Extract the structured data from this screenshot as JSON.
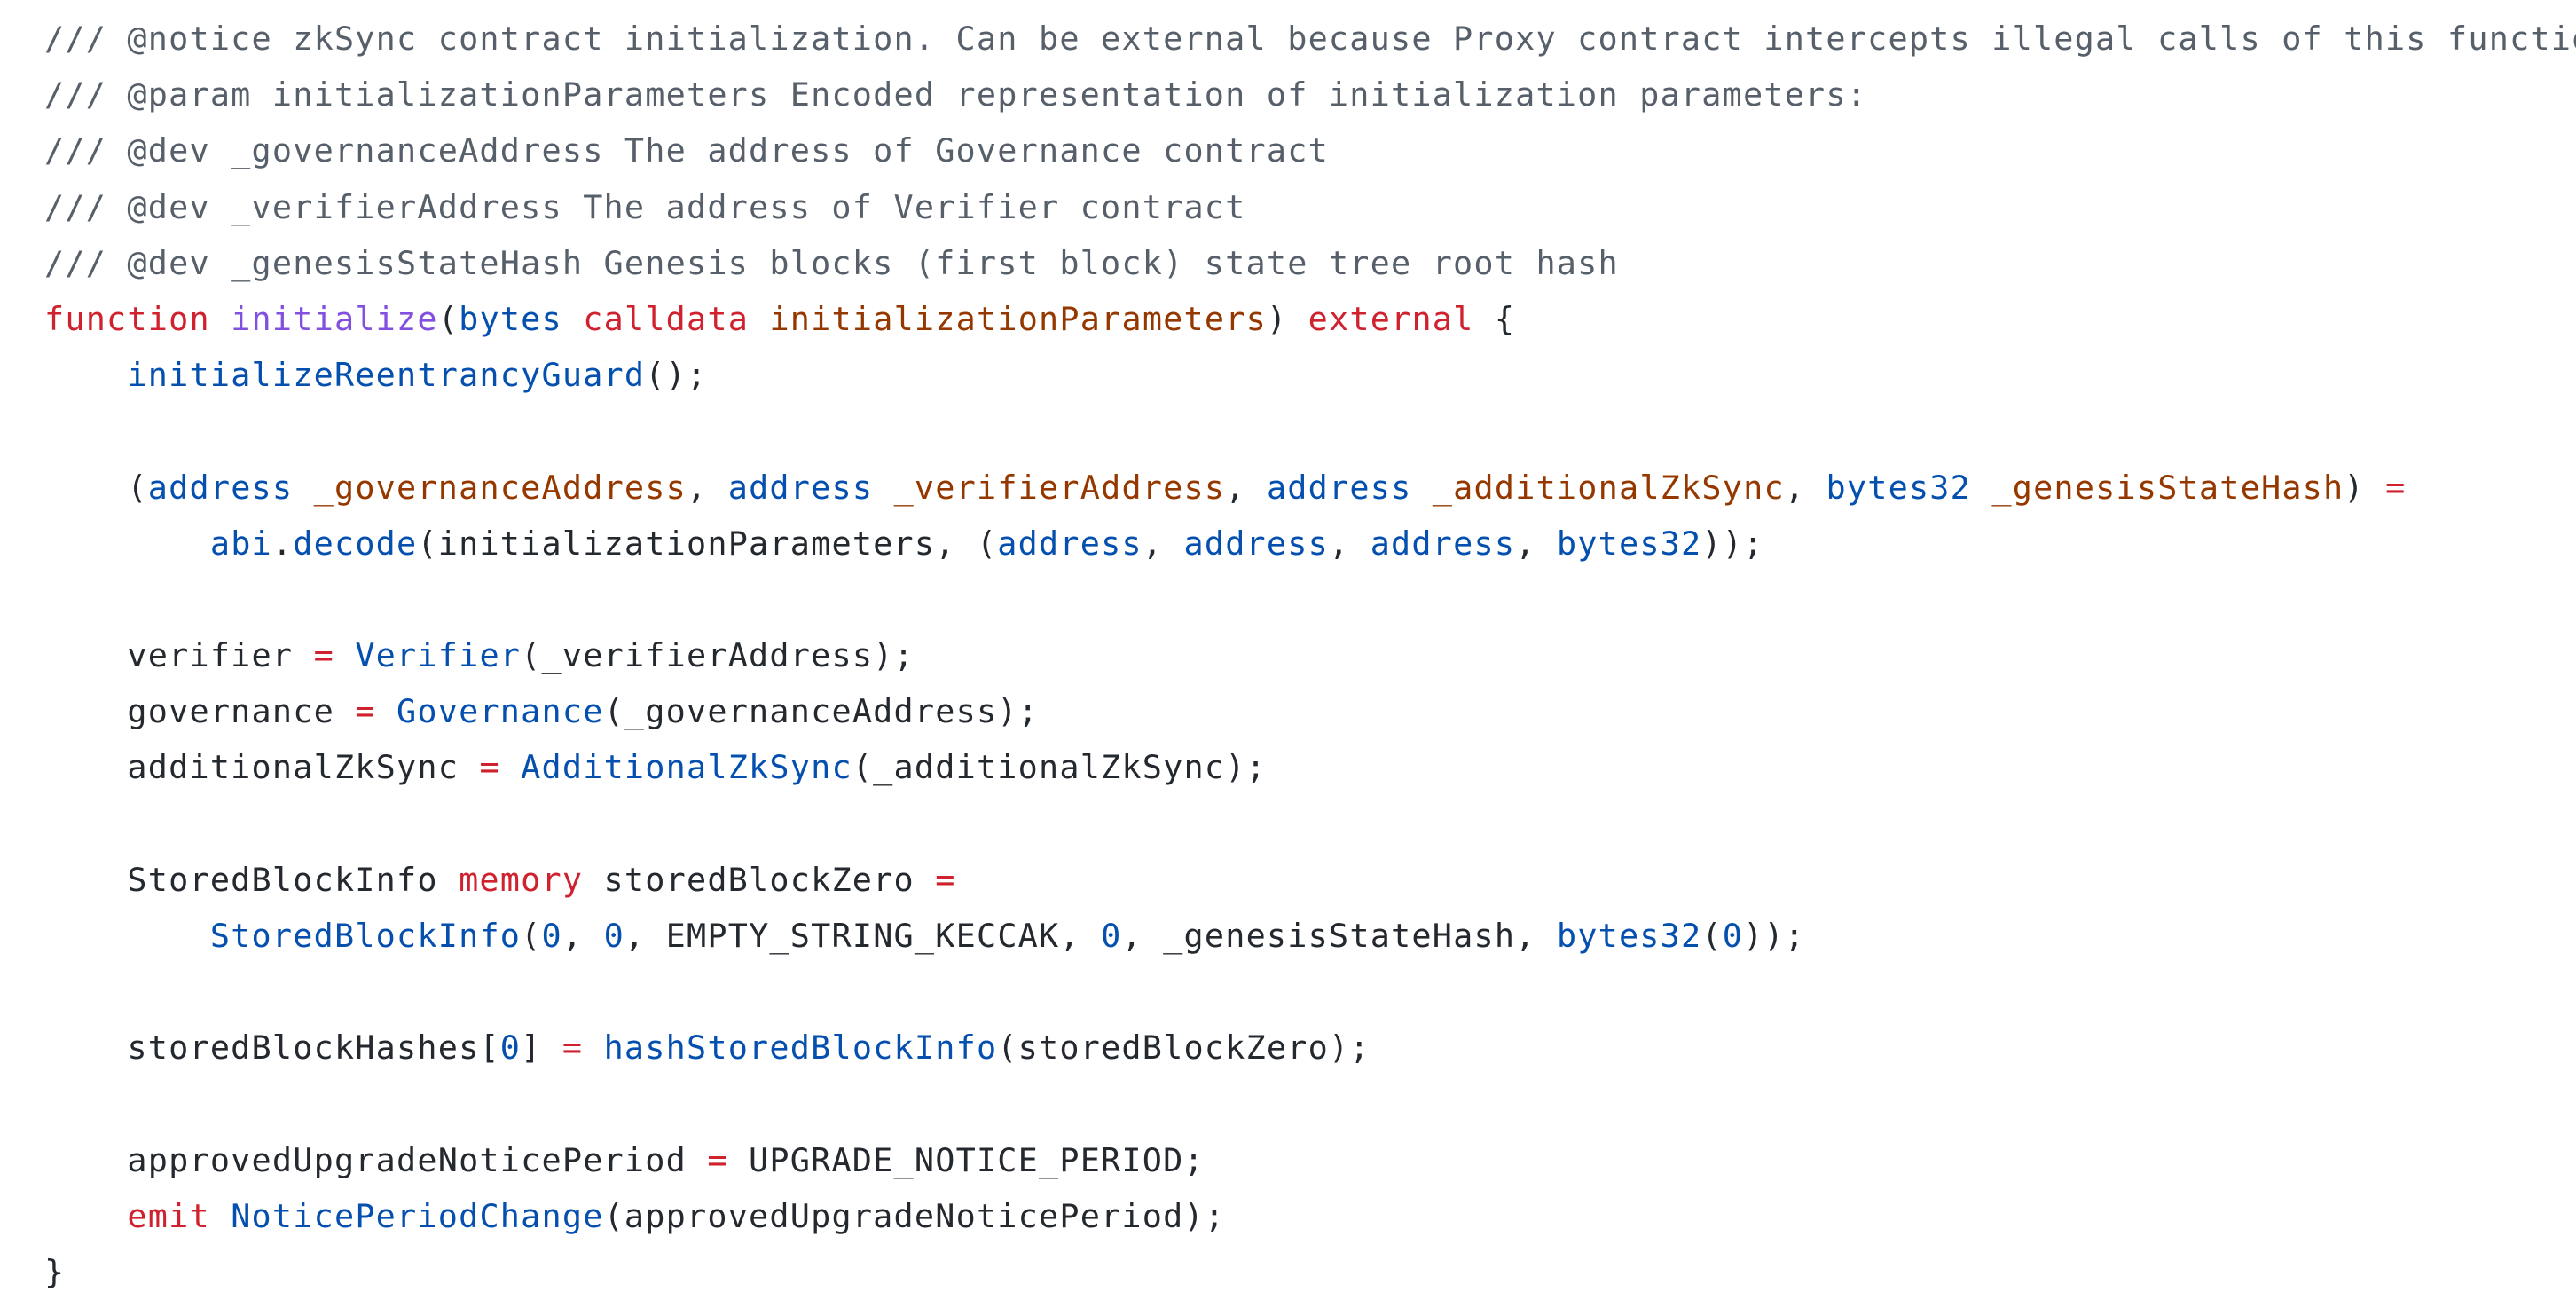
{
  "code": {
    "language": "Solidity",
    "colors": {
      "comment": "#57606a",
      "keyword": "#cf222e",
      "function": "#8250df",
      "type": "#0550ae",
      "param": "#953800",
      "plain": "#24292f",
      "background": "#ffffff"
    },
    "lines": [
      {
        "tokens": [
          {
            "k": "comment",
            "t": "/// @notice zkSync contract initialization. Can be external because Proxy contract intercepts illegal calls of this function."
          }
        ]
      },
      {
        "tokens": [
          {
            "k": "comment",
            "t": "/// @param initializationParameters Encoded representation of initialization parameters:"
          }
        ]
      },
      {
        "tokens": [
          {
            "k": "comment",
            "t": "/// @dev _governanceAddress The address of Governance contract"
          }
        ]
      },
      {
        "tokens": [
          {
            "k": "comment",
            "t": "/// @dev _verifierAddress The address of Verifier contract"
          }
        ]
      },
      {
        "tokens": [
          {
            "k": "comment",
            "t": "/// @dev _genesisStateHash Genesis blocks (first block) state tree root hash"
          }
        ]
      },
      {
        "tokens": [
          {
            "k": "keyword",
            "t": "function"
          },
          {
            "k": "plain",
            "t": " "
          },
          {
            "k": "function",
            "t": "initialize"
          },
          {
            "k": "plain",
            "t": "("
          },
          {
            "k": "type",
            "t": "bytes"
          },
          {
            "k": "plain",
            "t": " "
          },
          {
            "k": "keyword",
            "t": "calldata"
          },
          {
            "k": "plain",
            "t": " "
          },
          {
            "k": "param",
            "t": "initializationParameters"
          },
          {
            "k": "plain",
            "t": ") "
          },
          {
            "k": "keyword",
            "t": "external"
          },
          {
            "k": "plain",
            "t": " {"
          }
        ]
      },
      {
        "tokens": [
          {
            "k": "plain",
            "t": "    "
          },
          {
            "k": "call",
            "t": "initializeReentrancyGuard"
          },
          {
            "k": "plain",
            "t": "();"
          }
        ]
      },
      {
        "tokens": []
      },
      {
        "tokens": [
          {
            "k": "plain",
            "t": "    ("
          },
          {
            "k": "type",
            "t": "address"
          },
          {
            "k": "plain",
            "t": " "
          },
          {
            "k": "param",
            "t": "_governanceAddress"
          },
          {
            "k": "plain",
            "t": ", "
          },
          {
            "k": "type",
            "t": "address"
          },
          {
            "k": "plain",
            "t": " "
          },
          {
            "k": "param",
            "t": "_verifierAddress"
          },
          {
            "k": "plain",
            "t": ", "
          },
          {
            "k": "type",
            "t": "address"
          },
          {
            "k": "plain",
            "t": " "
          },
          {
            "k": "param",
            "t": "_additionalZkSync"
          },
          {
            "k": "plain",
            "t": ", "
          },
          {
            "k": "type",
            "t": "bytes32"
          },
          {
            "k": "plain",
            "t": " "
          },
          {
            "k": "param",
            "t": "_genesisStateHash"
          },
          {
            "k": "plain",
            "t": ") "
          },
          {
            "k": "operator",
            "t": "="
          }
        ]
      },
      {
        "tokens": [
          {
            "k": "plain",
            "t": "        "
          },
          {
            "k": "call",
            "t": "abi"
          },
          {
            "k": "plain",
            "t": "."
          },
          {
            "k": "call",
            "t": "decode"
          },
          {
            "k": "plain",
            "t": "(initializationParameters, ("
          },
          {
            "k": "type",
            "t": "address"
          },
          {
            "k": "plain",
            "t": ", "
          },
          {
            "k": "type",
            "t": "address"
          },
          {
            "k": "plain",
            "t": ", "
          },
          {
            "k": "type",
            "t": "address"
          },
          {
            "k": "plain",
            "t": ", "
          },
          {
            "k": "type",
            "t": "bytes32"
          },
          {
            "k": "plain",
            "t": "));"
          }
        ]
      },
      {
        "tokens": []
      },
      {
        "tokens": [
          {
            "k": "plain",
            "t": "    verifier "
          },
          {
            "k": "operator",
            "t": "="
          },
          {
            "k": "plain",
            "t": " "
          },
          {
            "k": "call",
            "t": "Verifier"
          },
          {
            "k": "plain",
            "t": "(_verifierAddress);"
          }
        ]
      },
      {
        "tokens": [
          {
            "k": "plain",
            "t": "    governance "
          },
          {
            "k": "operator",
            "t": "="
          },
          {
            "k": "plain",
            "t": " "
          },
          {
            "k": "call",
            "t": "Governance"
          },
          {
            "k": "plain",
            "t": "(_governanceAddress);"
          }
        ]
      },
      {
        "tokens": [
          {
            "k": "plain",
            "t": "    additionalZkSync "
          },
          {
            "k": "operator",
            "t": "="
          },
          {
            "k": "plain",
            "t": " "
          },
          {
            "k": "call",
            "t": "AdditionalZkSync"
          },
          {
            "k": "plain",
            "t": "(_additionalZkSync);"
          }
        ]
      },
      {
        "tokens": []
      },
      {
        "tokens": [
          {
            "k": "plain",
            "t": "    StoredBlockInfo "
          },
          {
            "k": "keyword",
            "t": "memory"
          },
          {
            "k": "plain",
            "t": " storedBlockZero "
          },
          {
            "k": "operator",
            "t": "="
          }
        ]
      },
      {
        "tokens": [
          {
            "k": "plain",
            "t": "        "
          },
          {
            "k": "call",
            "t": "StoredBlockInfo"
          },
          {
            "k": "plain",
            "t": "("
          },
          {
            "k": "number",
            "t": "0"
          },
          {
            "k": "plain",
            "t": ", "
          },
          {
            "k": "number",
            "t": "0"
          },
          {
            "k": "plain",
            "t": ", EMPTY_STRING_KECCAK, "
          },
          {
            "k": "number",
            "t": "0"
          },
          {
            "k": "plain",
            "t": ", _genesisStateHash, "
          },
          {
            "k": "type",
            "t": "bytes32"
          },
          {
            "k": "plain",
            "t": "("
          },
          {
            "k": "number",
            "t": "0"
          },
          {
            "k": "plain",
            "t": "));"
          }
        ]
      },
      {
        "tokens": []
      },
      {
        "tokens": [
          {
            "k": "plain",
            "t": "    storedBlockHashes["
          },
          {
            "k": "number",
            "t": "0"
          },
          {
            "k": "plain",
            "t": "] "
          },
          {
            "k": "operator",
            "t": "="
          },
          {
            "k": "plain",
            "t": " "
          },
          {
            "k": "call",
            "t": "hashStoredBlockInfo"
          },
          {
            "k": "plain",
            "t": "(storedBlockZero);"
          }
        ]
      },
      {
        "tokens": []
      },
      {
        "tokens": [
          {
            "k": "plain",
            "t": "    approvedUpgradeNoticePeriod "
          },
          {
            "k": "operator",
            "t": "="
          },
          {
            "k": "plain",
            "t": " UPGRADE_NOTICE_PERIOD;"
          }
        ]
      },
      {
        "tokens": [
          {
            "k": "plain",
            "t": "    "
          },
          {
            "k": "keyword",
            "t": "emit"
          },
          {
            "k": "plain",
            "t": " "
          },
          {
            "k": "call",
            "t": "NoticePeriodChange"
          },
          {
            "k": "plain",
            "t": "(approvedUpgradeNoticePeriod);"
          }
        ]
      },
      {
        "tokens": [
          {
            "k": "plain",
            "t": "}"
          }
        ]
      }
    ]
  }
}
